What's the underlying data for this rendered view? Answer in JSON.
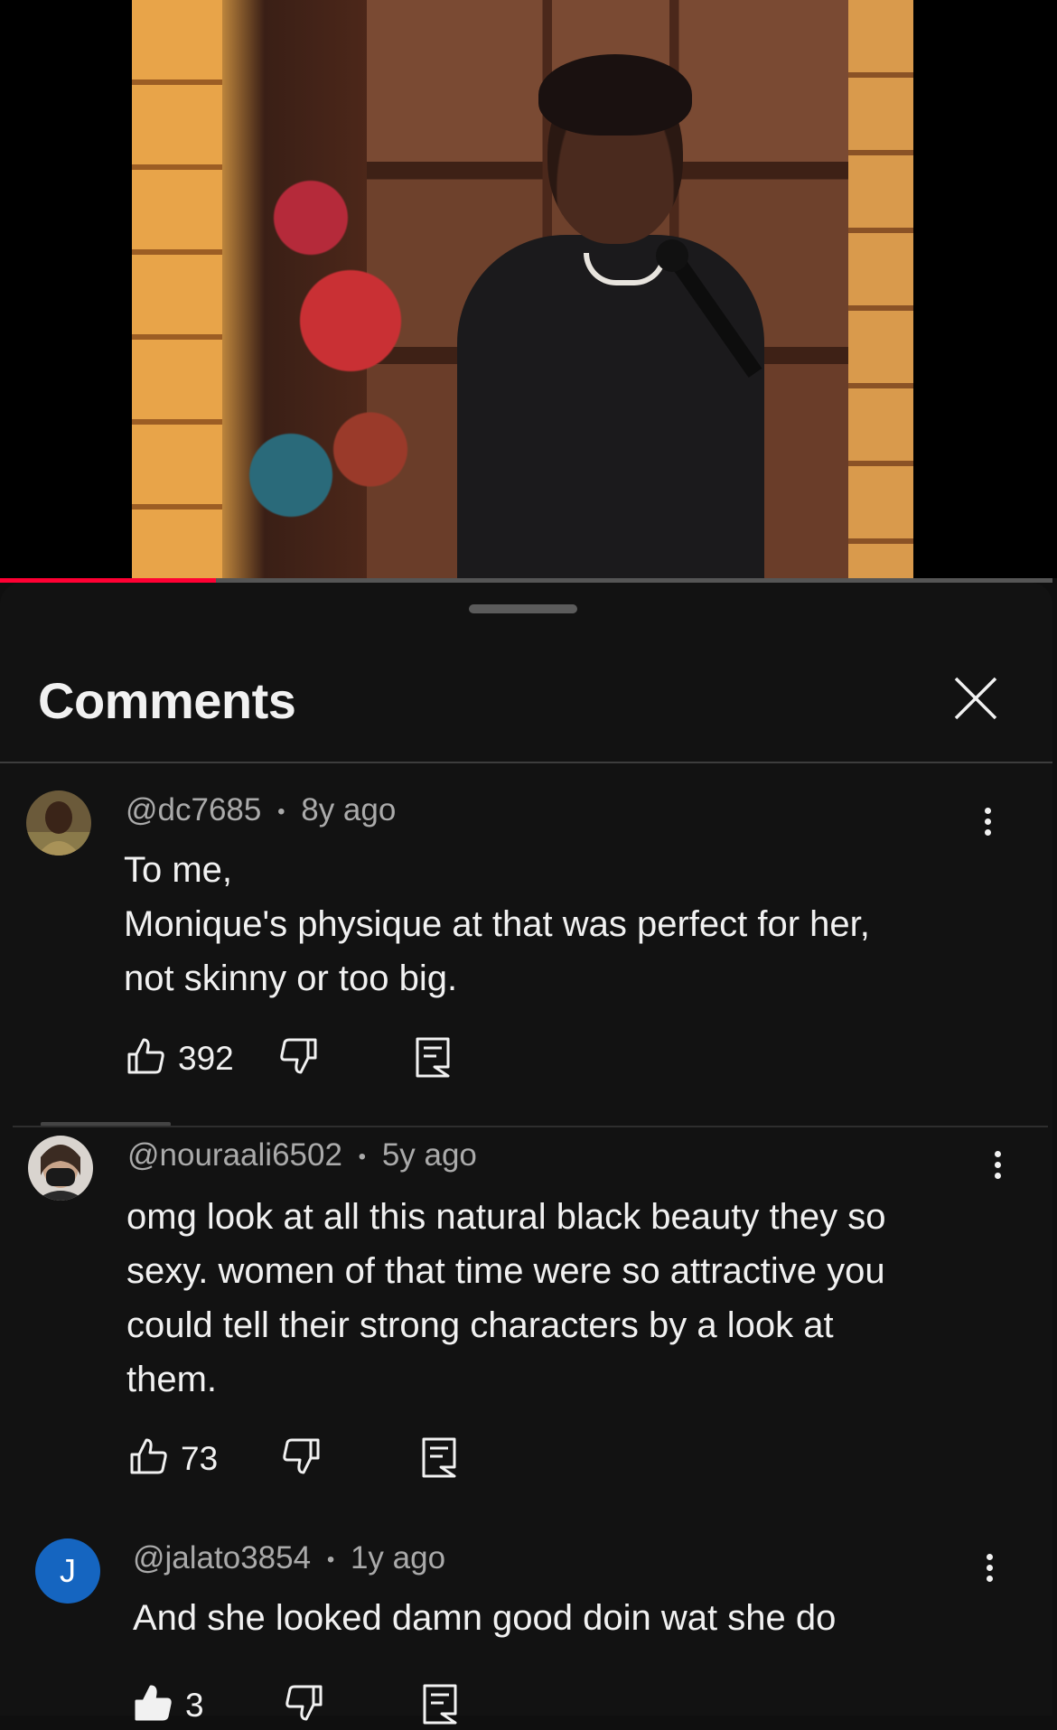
{
  "player": {
    "progress_fraction": 0.205,
    "progress_color": "#ff0033"
  },
  "sheet": {
    "title": "Comments",
    "close_icon": "close-icon"
  },
  "comments": [
    {
      "avatar_icon": "user-photo-avatar",
      "author": "@dc7685",
      "separator": "•",
      "age": "8y ago",
      "lines": [
        "To me,",
        "Monique's physique at that was perfect for her,",
        "not skinny or too big."
      ],
      "likes": "392"
    },
    {
      "avatar_icon": "user-photo-avatar",
      "author": "@nouraali6502",
      "separator": "•",
      "age": "5y ago",
      "lines": [
        "omg look at all this natural black beauty they so",
        "sexy. women of that time were so attractive you",
        "could tell their strong characters by a look at",
        "them."
      ],
      "likes": "73"
    },
    {
      "avatar_letter": "J",
      "avatar_color": "#1565c0",
      "author": "@jalato3854",
      "separator": "•",
      "age": "1y ago",
      "lines": [
        "And she looked damn good doin wat she do"
      ],
      "likes": "3"
    }
  ],
  "icons": {
    "like": "thumbs-up-icon",
    "dislike": "thumbs-down-icon",
    "reply": "reply-icon",
    "more": "more-vertical-icon"
  }
}
